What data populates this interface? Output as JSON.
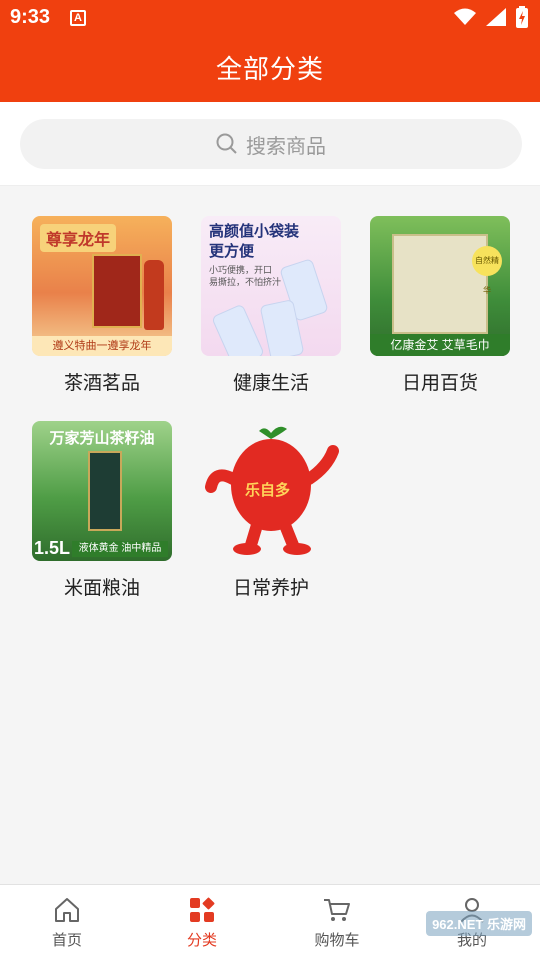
{
  "status_bar": {
    "time": "9:33",
    "notification_glyph": "A",
    "icons": [
      "wifi-icon",
      "signal-icon",
      "battery-icon"
    ]
  },
  "header": {
    "title": "全部分类"
  },
  "search": {
    "placeholder": "搜索商品"
  },
  "categories": [
    {
      "label": "茶酒茗品",
      "thumb_head": "尊享龙年",
      "thumb_band": "遵义特曲一遵享龙年"
    },
    {
      "label": "健康生活",
      "thumb_head": "高颜值小袋装\n更方便",
      "thumb_sub": "小巧便携，开口\n易撕拉，不怕挤汁"
    },
    {
      "label": "日用百货",
      "thumb_band": "亿康金艾 艾草毛巾",
      "thumb_badge": "自然精华"
    },
    {
      "label": "米面粮油",
      "thumb_head": "万家芳山茶籽油",
      "thumb_size": "1.5L",
      "thumb_band": "液体黄金 油中精品"
    },
    {
      "label": "日常养护",
      "mascot_text": "乐自多"
    }
  ],
  "bottom_nav": [
    {
      "label": "首页",
      "icon": "home-icon",
      "active": false
    },
    {
      "label": "分类",
      "icon": "category-icon",
      "active": true
    },
    {
      "label": "购物车",
      "icon": "cart-icon",
      "active": false
    },
    {
      "label": "我的",
      "icon": "user-icon",
      "active": false
    }
  ],
  "watermark": "962.NET 乐游网",
  "colors": {
    "brand": "#f0400f",
    "active_nav": "#e33b22"
  }
}
